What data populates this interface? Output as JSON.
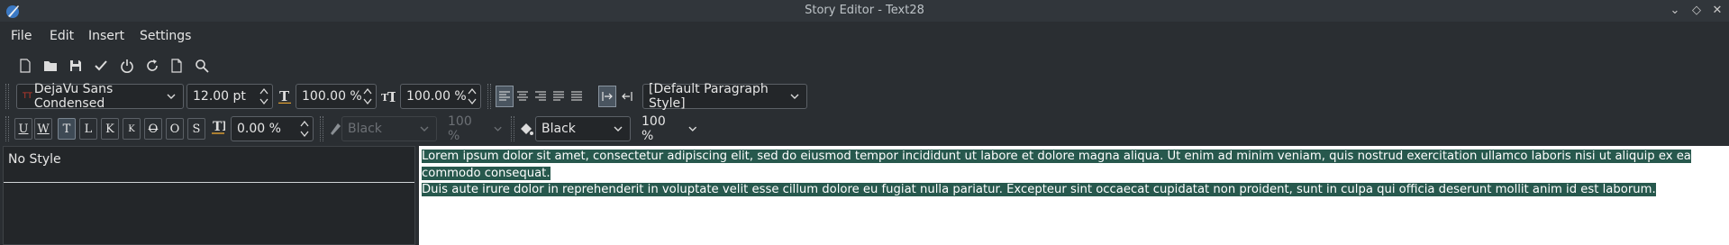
{
  "window": {
    "title": "Story Editor - Text28",
    "controls": [
      "chevron-down",
      "restore",
      "close"
    ]
  },
  "menu": [
    "File",
    "Edit",
    "Insert",
    "Settings"
  ],
  "toolbar": {
    "icons": [
      "new-document-icon",
      "open-folder-icon",
      "save-icon",
      "checkmark-icon",
      "power-icon",
      "reload-icon",
      "document-icon",
      "search-icon"
    ]
  },
  "format_row": {
    "font_family": "DejaVu Sans Condensed",
    "font_size": "12.00 pt",
    "scale_width": "100.00 %",
    "scale_height": "100.00 %",
    "paragraph_style": "[Default Paragraph Style]"
  },
  "effects_row": {
    "effect_buttons": [
      "U",
      "W",
      "T",
      "L",
      "K",
      "K",
      "O",
      "O",
      "S"
    ],
    "tracking": "0.00 %",
    "stroke_color": "Black",
    "stroke_shade": "100 %",
    "fill_color": "Black",
    "fill_shade": "100 %"
  },
  "styles_panel": {
    "current_style": "No Style"
  },
  "editor": {
    "line1": "Lorem ipsum dolor sit amet, consectetur adipiscing elit, sed do eiusmod tempor incididunt ut labore et dolore magna aliqua. Ut enim ad minim veniam, quis nostrud exercitation ullamco laboris nisi ut aliquip ex ea commodo consequat.",
    "line2": "Duis aute irure dolor in reprehenderit in voluptate velit esse cillum dolore eu fugiat nulla pariatur. Excepteur sint occaecat cupidatat non proident, sunt in culpa qui officia deserunt mollit anim id est laborum.",
    "selection_color": "#27584d"
  }
}
